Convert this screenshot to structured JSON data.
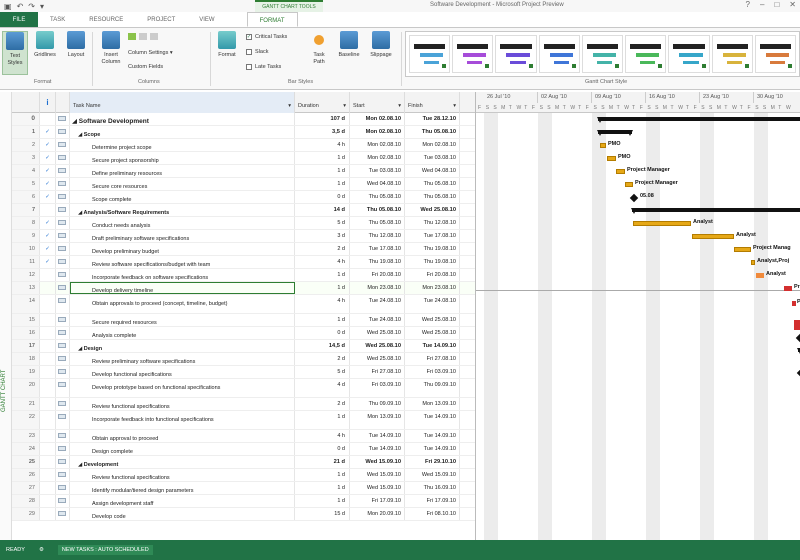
{
  "window": {
    "title": "Software Development - Microsoft Project Preview",
    "context_tab_title": "GANTT CHART TOOLS"
  },
  "tabs": [
    "FILE",
    "TASK",
    "RESOURCE",
    "PROJECT",
    "VIEW",
    "FORMAT"
  ],
  "ribbon": {
    "format_group": {
      "label": "Format",
      "text_styles": "Text\nStyles",
      "gridlines": "Gridlines",
      "layout": "Layout"
    },
    "columns_group": {
      "label": "Columns",
      "insert_column": "Insert\nColumn",
      "column_settings": "Column Settings",
      "custom_fields": "Custom Fields"
    },
    "bar_styles_group": {
      "label": "Bar Styles",
      "format": "Format",
      "critical_tasks": "Critical Tasks",
      "slack": "Slack",
      "late_tasks": "Late Tasks",
      "task_path": "Task\nPath",
      "baseline": "Baseline",
      "slippage": "Slippage"
    },
    "gantt_style_group": {
      "label": "Gantt Chart Style",
      "styles": [
        "#4aa3d8",
        "#a64cd9",
        "#6a4cd9",
        "#3f76d8",
        "#44b3a8",
        "#4ab85a",
        "#36a6c9",
        "#d8b33c",
        "#d87a3c"
      ]
    }
  },
  "grid": {
    "headers": {
      "info": "i",
      "name": "Task Name",
      "duration": "Duration",
      "start": "Start",
      "finish": "Finish"
    },
    "rows": [
      {
        "id": "0",
        "check": "",
        "name": "◢ Software Development",
        "duration": "107 d",
        "start": "Mon 02.08.10",
        "finish": "Tue 28.12.10",
        "level": 0,
        "summary": true,
        "project": true
      },
      {
        "id": "1",
        "check": "✓",
        "name": "◢ Scope",
        "duration": "3,5 d",
        "start": "Mon 02.08.10",
        "finish": "Thu 05.08.10",
        "level": 1,
        "summary": true
      },
      {
        "id": "2",
        "check": "✓",
        "name": "Determine project scope",
        "duration": "4 h",
        "start": "Mon 02.08.10",
        "finish": "Mon 02.08.10",
        "level": 2
      },
      {
        "id": "3",
        "check": "✓",
        "name": "Secure project sponsorship",
        "duration": "1 d",
        "start": "Mon 02.08.10",
        "finish": "Tue 03.08.10",
        "level": 2
      },
      {
        "id": "4",
        "check": "✓",
        "name": "Define preliminary resources",
        "duration": "1 d",
        "start": "Tue 03.08.10",
        "finish": "Wed 04.08.10",
        "level": 2
      },
      {
        "id": "5",
        "check": "✓",
        "name": "Secure core resources",
        "duration": "1 d",
        "start": "Wed 04.08.10",
        "finish": "Thu 05.08.10",
        "level": 2
      },
      {
        "id": "6",
        "check": "✓",
        "name": "Scope complete",
        "duration": "0 d",
        "start": "Thu 05.08.10",
        "finish": "Thu 05.08.10",
        "level": 2
      },
      {
        "id": "7",
        "check": "",
        "name": "◢ Analysis/Software Requirements",
        "duration": "14 d",
        "start": "Thu 05.08.10",
        "finish": "Wed 25.08.10",
        "level": 1,
        "summary": true
      },
      {
        "id": "8",
        "check": "✓",
        "name": "Conduct needs analysis",
        "duration": "5 d",
        "start": "Thu 05.08.10",
        "finish": "Thu 12.08.10",
        "level": 2
      },
      {
        "id": "9",
        "check": "✓",
        "name": "Draft preliminary software specifications",
        "duration": "3 d",
        "start": "Thu 12.08.10",
        "finish": "Tue 17.08.10",
        "level": 2
      },
      {
        "id": "10",
        "check": "✓",
        "name": "Develop preliminary budget",
        "duration": "2 d",
        "start": "Tue 17.08.10",
        "finish": "Thu 19.08.10",
        "level": 2
      },
      {
        "id": "11",
        "check": "✓",
        "name": "Review software specifications/budget with team",
        "duration": "4 h",
        "start": "Thu 19.08.10",
        "finish": "Thu 19.08.10",
        "level": 2
      },
      {
        "id": "12",
        "check": "",
        "name": "Incorporate feedback on software specifications",
        "duration": "1 d",
        "start": "Fri 20.08.10",
        "finish": "Fri 20.08.10",
        "level": 2
      },
      {
        "id": "13",
        "check": "",
        "name": "Develop delivery timeline",
        "duration": "1 d",
        "start": "Mon 23.08.10",
        "finish": "Mon 23.08.10",
        "level": 2,
        "selected": true
      },
      {
        "id": "14",
        "check": "",
        "name": "Obtain approvals to proceed (concept, timeline, budget)",
        "duration": "4 h",
        "start": "Tue 24.08.10",
        "finish": "Tue 24.08.10",
        "level": 2,
        "tall": true
      },
      {
        "id": "15",
        "check": "",
        "name": "Secure required resources",
        "duration": "1 d",
        "start": "Tue 24.08.10",
        "finish": "Wed 25.08.10",
        "level": 2
      },
      {
        "id": "16",
        "check": "",
        "name": "Analysis complete",
        "duration": "0 d",
        "start": "Wed 25.08.10",
        "finish": "Wed 25.08.10",
        "level": 2
      },
      {
        "id": "17",
        "check": "",
        "name": "◢ Design",
        "duration": "14,5 d",
        "start": "Wed 25.08.10",
        "finish": "Tue 14.09.10",
        "level": 1,
        "summary": true
      },
      {
        "id": "18",
        "check": "",
        "name": "Review preliminary software specifications",
        "duration": "2 d",
        "start": "Wed 25.08.10",
        "finish": "Fri 27.08.10",
        "level": 2
      },
      {
        "id": "19",
        "check": "",
        "name": "Develop functional specifications",
        "duration": "5 d",
        "start": "Fri 27.08.10",
        "finish": "Fri 03.09.10",
        "level": 2
      },
      {
        "id": "20",
        "check": "",
        "name": "Develop prototype based on functional specifications",
        "duration": "4 d",
        "start": "Fri 03.09.10",
        "finish": "Thu 09.09.10",
        "level": 2,
        "tall": true
      },
      {
        "id": "21",
        "check": "",
        "name": "Review functional specifications",
        "duration": "2 d",
        "start": "Thu 09.09.10",
        "finish": "Mon 13.09.10",
        "level": 2
      },
      {
        "id": "22",
        "check": "",
        "name": "Incorporate feedback into functional specifications",
        "duration": "1 d",
        "start": "Mon 13.09.10",
        "finish": "Tue 14.09.10",
        "level": 2,
        "tall": true
      },
      {
        "id": "23",
        "check": "",
        "name": "Obtain approval to proceed",
        "duration": "4 h",
        "start": "Tue 14.09.10",
        "finish": "Tue 14.09.10",
        "level": 2
      },
      {
        "id": "24",
        "check": "",
        "name": "Design complete",
        "duration": "0 d",
        "start": "Tue 14.09.10",
        "finish": "Tue 14.09.10",
        "level": 2
      },
      {
        "id": "25",
        "check": "",
        "name": "◢ Development",
        "duration": "21 d",
        "start": "Wed 15.09.10",
        "finish": "Fri 29.10.10",
        "level": 1,
        "summary": true
      },
      {
        "id": "26",
        "check": "",
        "name": "Review functional specifications",
        "duration": "1 d",
        "start": "Wed 15.09.10",
        "finish": "Wed 15.09.10",
        "level": 2
      },
      {
        "id": "27",
        "check": "",
        "name": "Identify modular/tiered design parameters",
        "duration": "1 d",
        "start": "Wed 15.09.10",
        "finish": "Thu 16.09.10",
        "level": 2
      },
      {
        "id": "28",
        "check": "",
        "name": "Assign development staff",
        "duration": "1 d",
        "start": "Fri 17.09.10",
        "finish": "Fri 17.09.10",
        "level": 2
      },
      {
        "id": "29",
        "check": "",
        "name": "Develop code",
        "duration": "15 d",
        "start": "Mon 20.09.10",
        "finish": "Fri 08.10.10",
        "level": 2
      }
    ]
  },
  "gantt": {
    "weeks": [
      "26 Jul '10",
      "02 Aug '10",
      "09 Aug '10",
      "16 Aug '10",
      "23 Aug '10",
      "30 Aug '10"
    ],
    "day_letters": [
      "F",
      "S",
      "S",
      "M",
      "T",
      "W",
      "T",
      "F",
      "S",
      "S",
      "M",
      "T",
      "W",
      "T",
      "F",
      "S",
      "S",
      "M",
      "T",
      "W",
      "T",
      "F",
      "S",
      "S",
      "M",
      "T",
      "W",
      "T",
      "F",
      "S",
      "S",
      "M",
      "T",
      "W",
      "T",
      "F",
      "S",
      "S",
      "M",
      "T",
      "W"
    ],
    "labels": {
      "l2": "PMO",
      "l3": "PMO",
      "l4": "Project Manager",
      "l5": "Project Manager",
      "l6": "05.08",
      "l8": "Analyst",
      "l9": "Analyst",
      "l10": "Project Manag",
      "l11": "Analyst,Proj",
      "l12": "Analyst",
      "l13": "Pr",
      "l14": "P"
    }
  },
  "side_view_label": "GANTT CHART",
  "status": {
    "ready": "READY",
    "new_tasks": "NEW TASKS : AUTO SCHEDULED"
  }
}
